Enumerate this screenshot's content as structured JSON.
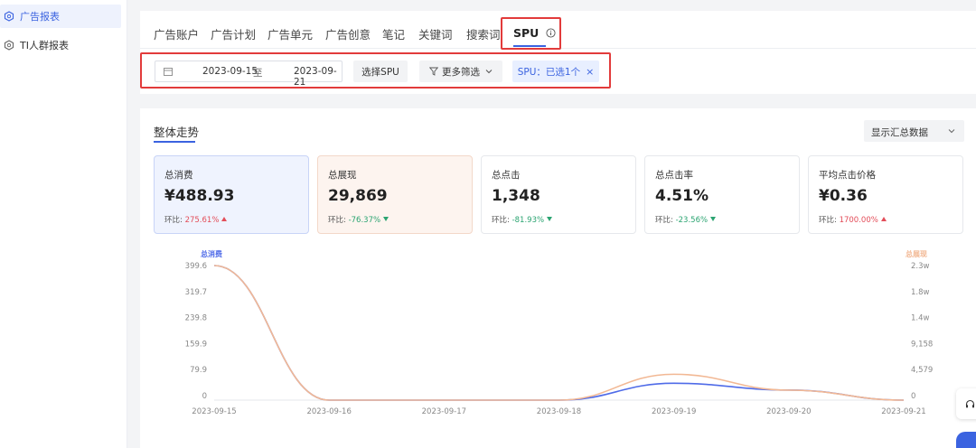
{
  "sidebar": {
    "items": [
      {
        "label": "广告报表",
        "icon": "hexagon-icon",
        "active": true
      },
      {
        "label": "TI人群报表",
        "icon": "hexagon-icon",
        "active": false
      }
    ]
  },
  "tabs": [
    {
      "label": "广告账户"
    },
    {
      "label": "广告计划"
    },
    {
      "label": "广告单元"
    },
    {
      "label": "广告创意"
    },
    {
      "label": "笔记"
    },
    {
      "label": "关键词"
    },
    {
      "label": "搜索词"
    },
    {
      "label": "SPU",
      "active": true,
      "icon": "info-circle-icon"
    }
  ],
  "filters": {
    "date_start": "2023-09-15",
    "date_sep": "至",
    "date_end": "2023-09-21",
    "select_spu_label": "选择SPU",
    "more_filters_label": "更多筛选",
    "spu_tag_label": "SPU：已选1个",
    "spu_tag_close": "×"
  },
  "section": {
    "title": "整体走势",
    "display_select": "显示汇总数据"
  },
  "cards": [
    {
      "title": "总消费",
      "value": "¥488.93",
      "cmp_label": "环比:",
      "cmp_value": "275.61%",
      "direction": "up"
    },
    {
      "title": "总展现",
      "value": "29,869",
      "cmp_label": "环比:",
      "cmp_value": "-76.37%",
      "direction": "down"
    },
    {
      "title": "总点击",
      "value": "1,348",
      "cmp_label": "环比:",
      "cmp_value": "-81.93%",
      "direction": "down"
    },
    {
      "title": "总点击率",
      "value": "4.51%",
      "cmp_label": "环比:",
      "cmp_value": "-23.56%",
      "direction": "down"
    },
    {
      "title": "平均点击价格",
      "value": "¥0.36",
      "cmp_label": "环比:",
      "cmp_value": "1700.00%",
      "direction": "up"
    }
  ],
  "colors": {
    "accent": "#3b63e0",
    "up": "#e34d59",
    "down": "#2ba471",
    "highlight_box": "#e23b3b",
    "series_spend": "#4f6be8",
    "series_impressions": "#f2b894"
  },
  "chart_data": {
    "type": "line",
    "x": [
      "2023-09-15",
      "2023-09-16",
      "2023-09-17",
      "2023-09-18",
      "2023-09-19",
      "2023-09-20",
      "2023-09-21"
    ],
    "left_axis": {
      "label": "总消费",
      "ticks": [
        "399.6",
        "319.7",
        "239.8",
        "159.9",
        "79.9",
        "0"
      ],
      "range": [
        0,
        399.6
      ]
    },
    "right_axis": {
      "label": "总展现",
      "ticks": [
        "2.3w",
        "1.8w",
        "1.4w",
        "9,158",
        "4,579",
        "0"
      ],
      "range": [
        0,
        22895
      ]
    },
    "series": [
      {
        "name": "总消费",
        "axis": "left",
        "values": [
          399.6,
          0,
          0,
          0,
          50,
          30,
          0
        ]
      },
      {
        "name": "总展现",
        "axis": "right",
        "values": [
          22895,
          0,
          0,
          0,
          4400,
          1700,
          0
        ]
      }
    ],
    "grid": false,
    "legend": "none"
  }
}
